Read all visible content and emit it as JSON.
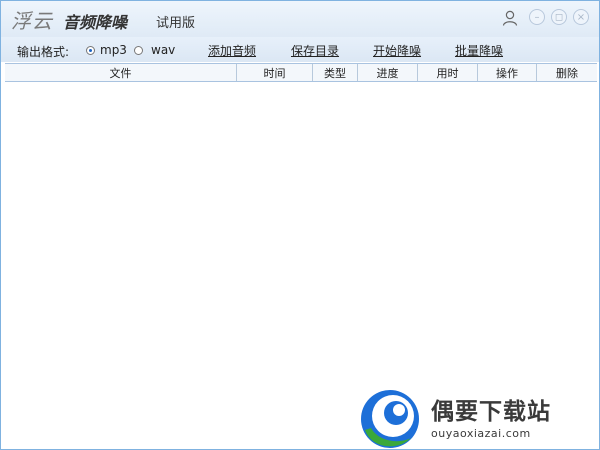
{
  "app": {
    "brand": "浮云",
    "product": "音频降噪",
    "edition": "试用版"
  },
  "titlebar": {
    "icons": [
      "user-icon",
      "minimize-icon",
      "restore-icon",
      "close-icon"
    ],
    "minimize_glyph": "–",
    "restore_glyph": "◻",
    "close_glyph": "×"
  },
  "toolbar": {
    "format_label": "输出格式:",
    "format_options": [
      {
        "label": "mp3",
        "selected": true
      },
      {
        "label": "wav",
        "selected": false
      }
    ],
    "buttons": {
      "add_audio": "添加音频",
      "save_dir": "保存目录",
      "start_denoise": "开始降噪",
      "batch_denoise": "批量降噪"
    }
  },
  "table": {
    "columns": [
      "文件",
      "时间",
      "类型",
      "进度",
      "用时",
      "操作",
      "删除"
    ],
    "rows": []
  },
  "watermark": {
    "title": "偶要下载站",
    "url": "ouyaoxiazai.com",
    "colors": {
      "blue": "#1d6fd8",
      "green": "#3aa83a"
    }
  }
}
